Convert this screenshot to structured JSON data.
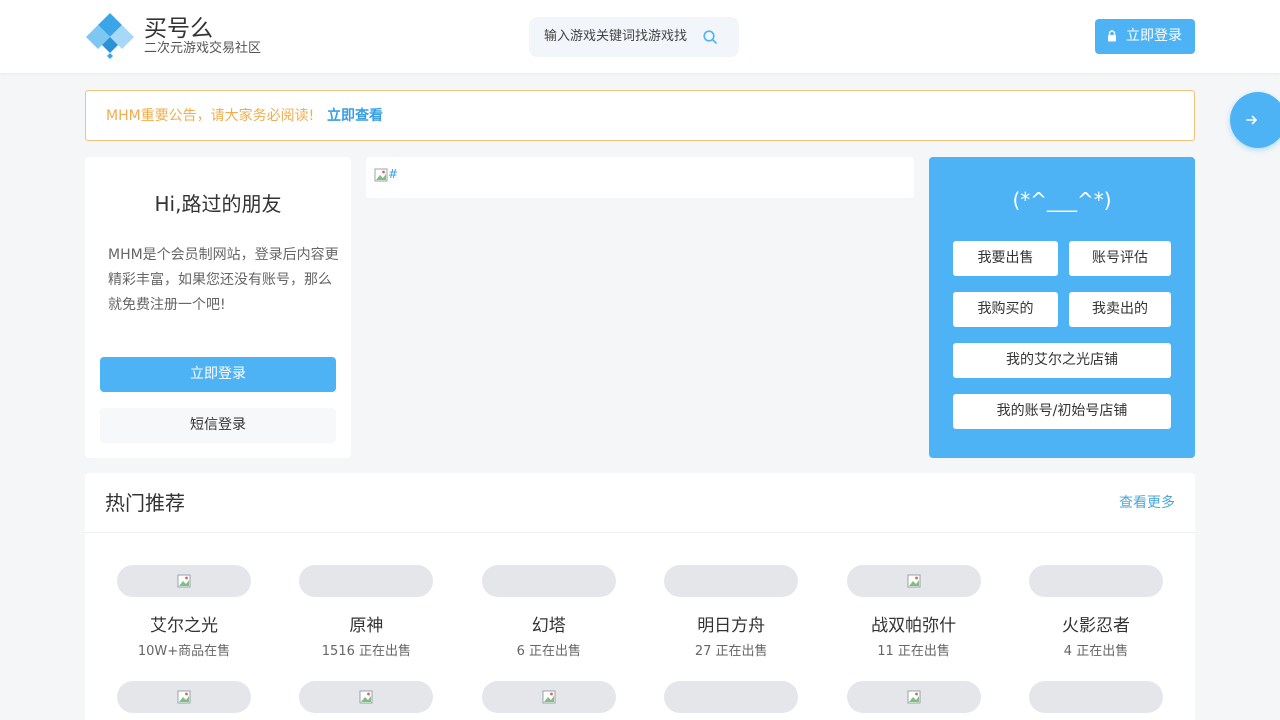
{
  "header": {
    "brand_title": "买号么",
    "brand_subtitle": "二次元游戏交易社区",
    "search_placeholder": "输入游戏关键词找游戏找",
    "login_label": "立即登录"
  },
  "notice": {
    "text": "MHM重要公告，请大家务必阅读!",
    "link_label": "立即查看"
  },
  "user_card": {
    "greeting": "Hi,路过的朋友",
    "intro": "MHM是个会员制网站，登录后内容更精彩丰富，如果您还没有账号，那么就免费注册一个吧!",
    "login_label": "立即登录",
    "sms_login_label": "短信登录"
  },
  "banner": {
    "alt_text": "#"
  },
  "quick_panel": {
    "emoticon": "(*^___^*)",
    "sell_label": "我要出售",
    "appraise_label": "账号评估",
    "bought_label": "我购买的",
    "sold_label": "我卖出的",
    "shop_label": "我的艾尔之光店铺",
    "account_shop_label": "我的账号/初始号店铺"
  },
  "hot": {
    "title": "热门推荐",
    "more_label": "查看更多",
    "games": [
      {
        "name": "艾尔之光",
        "count": "10W+商品在售",
        "has_image": true
      },
      {
        "name": "原神",
        "count": "1516 正在出售",
        "has_image": false
      },
      {
        "name": "幻塔",
        "count": "6 正在出售",
        "has_image": false
      },
      {
        "name": "明日方舟",
        "count": "27 正在出售",
        "has_image": false
      },
      {
        "name": "战双帕弥什",
        "count": "11 正在出售",
        "has_image": true
      },
      {
        "name": "火影忍者",
        "count": "4 正在出售",
        "has_image": false
      }
    ],
    "second_row_images": [
      true,
      true,
      true,
      false,
      true,
      false
    ]
  },
  "colors": {
    "accent": "#4db3f5",
    "notice_text": "#f0ad4e",
    "notice_border": "#f3c27c",
    "link": "#3a9ee6"
  }
}
